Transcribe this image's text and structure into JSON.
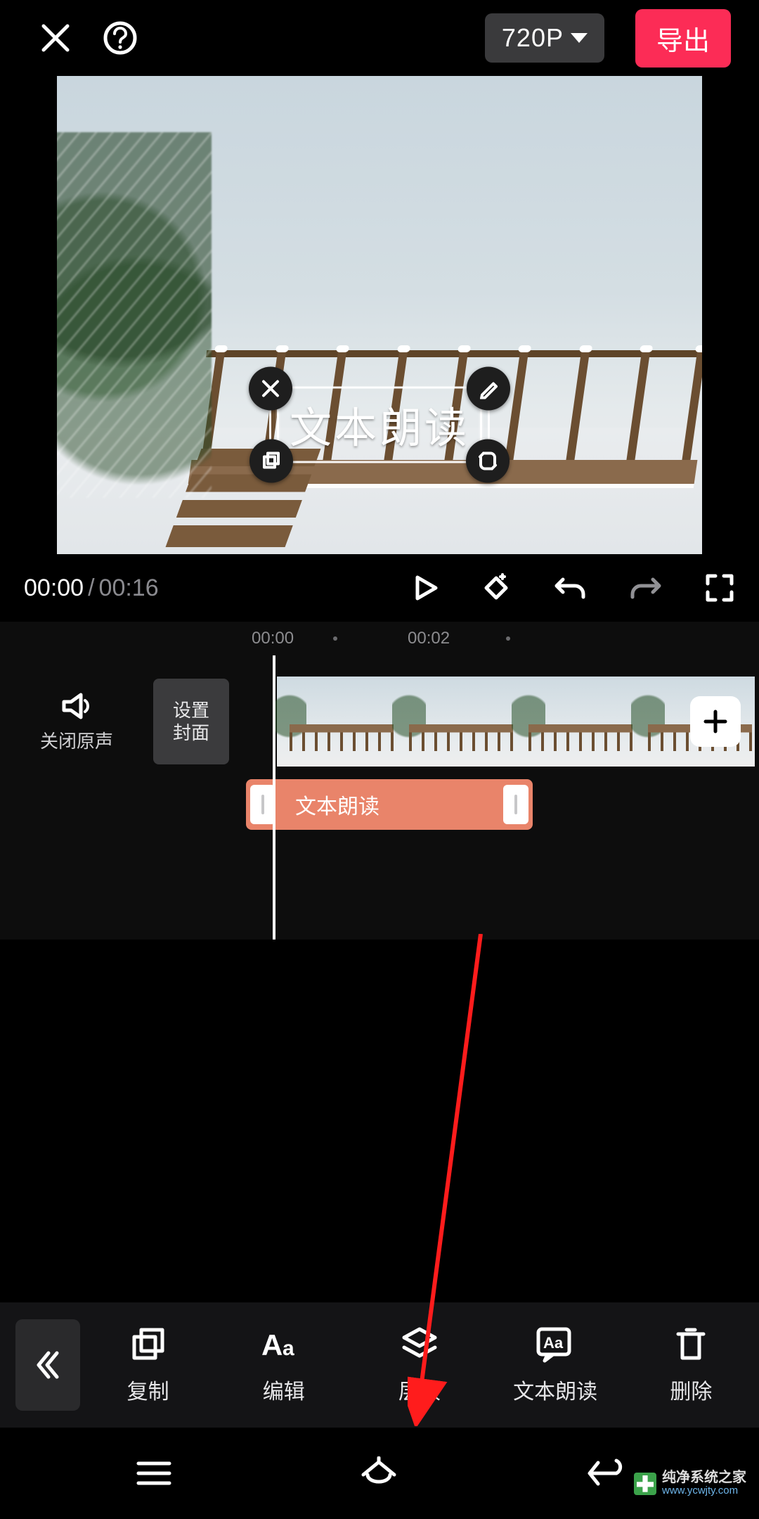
{
  "header": {
    "resolution_label": "720P",
    "export_label": "导出"
  },
  "preview": {
    "text_overlay": "文本朗读"
  },
  "playbar": {
    "current_time": "00:00",
    "separator": "/",
    "total_time": "00:16"
  },
  "timeline": {
    "ruler": {
      "t0": "00:00",
      "t1": "00:02"
    },
    "mute_label": "关闭原声",
    "cover_line1": "设置",
    "cover_line2": "封面",
    "text_clip_label": "文本朗读"
  },
  "toolbar": {
    "items": [
      {
        "label": "复制"
      },
      {
        "label": "编辑"
      },
      {
        "label": "层级"
      },
      {
        "label": "文本朗读"
      },
      {
        "label": "删除"
      }
    ]
  },
  "watermark": {
    "name": "纯净系统之家",
    "url": "www.ycwjty.com"
  }
}
